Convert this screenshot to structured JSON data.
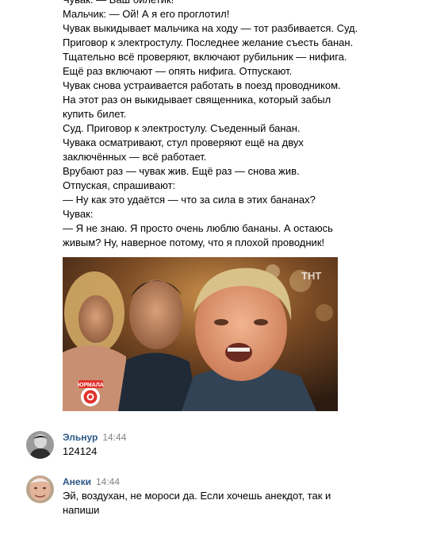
{
  "post": {
    "lines": [
      "Чувак: — Ваш билетик!",
      "Мальчик: — Ой! А я его проглотил!",
      "Чувак выкидывает мальчика на ходу — тот разбивается. Суд.",
      "Приговор к электростулу. Последнее желание съесть банан.",
      "Тщательно всё проверяют, включают рубильник — нифига.",
      "Ещё раз включают — опять нифига. Отпускают.",
      "Чувак снова устраивается работать в поезд проводником.",
      "На этот раз он выкидывает священника, который забыл",
      "купить билет.",
      "Суд. Приговор к электростулу. Съеденный банан.",
      "Чувака осматривают, стул проверяют ещё на двух",
      "заключённых — всё работает.",
      "Врубают раз — чувак жив. Ещё раз — снова жив.",
      "Отпуская, спрашивают:",
      "— Ну как это удаётся — что за сила в этих бананах?",
      "Чувак:",
      "— Я не знаю. Я просто очень люблю бананы. А остаюсь",
      "живым? Ну, наверное потому, что я плохой проводник!"
    ],
    "image": {
      "watermark": "ТНТ",
      "badge_text": "ЮРМАЛА"
    }
  },
  "comments": [
    {
      "author": "Эльнур",
      "time": "14:44",
      "text_lines": [
        "124124"
      ]
    },
    {
      "author": "Анеки",
      "time": "14:44",
      "text_lines": [
        "Эй, воздухан, не мороси да. Если хочешь анекдот, так и",
        "напиши"
      ]
    }
  ]
}
